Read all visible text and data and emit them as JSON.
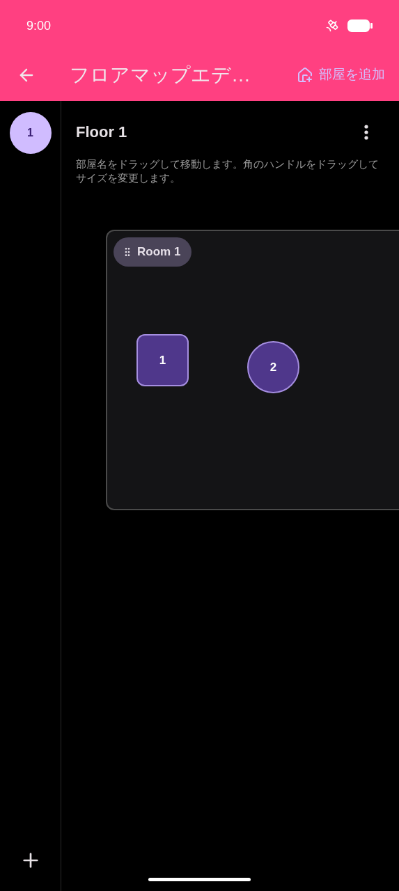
{
  "status_bar": {
    "time": "9:00"
  },
  "app_bar": {
    "title": "フロアマップエデ…",
    "action": "部屋を追加"
  },
  "floors": [
    {
      "label": "1",
      "selected": true
    }
  ],
  "floor": {
    "title": "Floor 1",
    "hint": "部屋名をドラッグして移動します。角のハンドルをドラッグしてサイズを変更します。"
  },
  "rooms": [
    {
      "name": "Room 1",
      "tables": [
        {
          "label": "1",
          "kind": "square"
        },
        {
          "label": "2",
          "kind": "round"
        }
      ]
    }
  ]
}
